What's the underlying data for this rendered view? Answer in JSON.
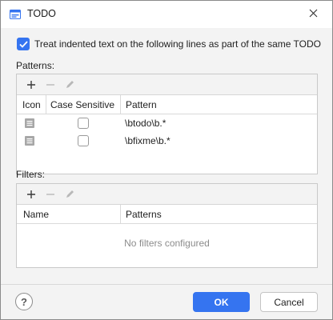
{
  "window": {
    "title": "TODO",
    "icon": "todo-app-icon",
    "close_icon": "close-icon"
  },
  "option": {
    "label": "Treat indented text on the following lines as part of the same TODO",
    "checked": true
  },
  "patterns": {
    "section_label": "Patterns:",
    "toolbar": {
      "add_icon": "plus-icon",
      "remove_icon": "minus-icon",
      "edit_icon": "pencil-icon"
    },
    "columns": [
      "Icon",
      "Case Sensitive",
      "Pattern"
    ],
    "rows": [
      {
        "icon": "todo-list-icon",
        "case_sensitive": false,
        "pattern": "\\btodo\\b.*"
      },
      {
        "icon": "todo-list-icon",
        "case_sensitive": false,
        "pattern": "\\bfixme\\b.*"
      }
    ]
  },
  "filters": {
    "section_label": "Filters:",
    "toolbar": {
      "add_icon": "plus-icon",
      "remove_icon": "minus-icon",
      "edit_icon": "pencil-icon"
    },
    "columns": [
      "Name",
      "Patterns"
    ],
    "empty_text": "No filters configured"
  },
  "footer": {
    "help_label": "?",
    "ok_label": "OK",
    "cancel_label": "Cancel"
  },
  "colors": {
    "accent": "#3574f0",
    "disabled_icon": "#b8b8b8"
  }
}
